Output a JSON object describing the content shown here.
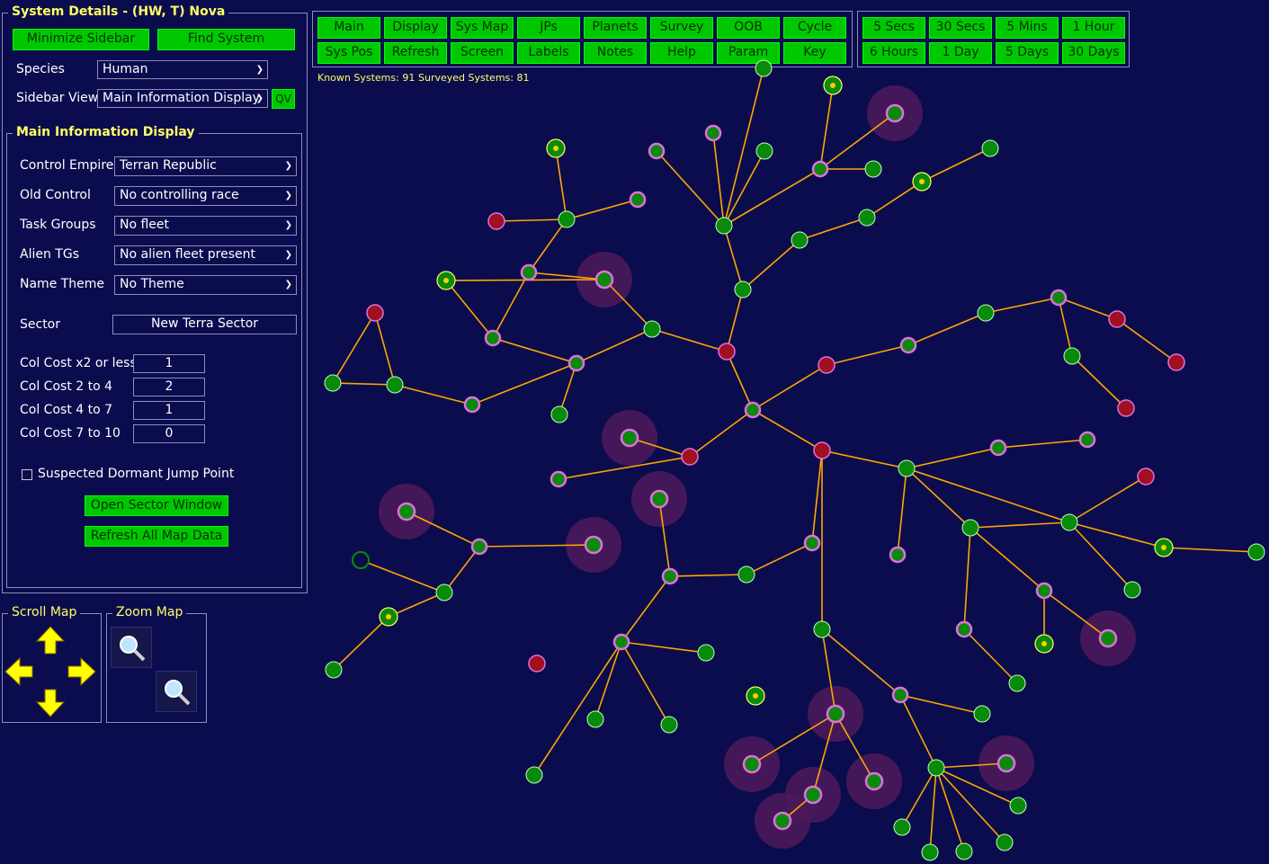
{
  "sidebar": {
    "title": "System Details - (HW, T) Nova",
    "minimize_label": "Minimize Sidebar",
    "find_label": "Find System",
    "species_label": "Species",
    "species_value": "Human",
    "sidebar_view_label": "Sidebar View",
    "sidebar_view_value": "Main Information Display",
    "qv_label": "QV",
    "mid_title": "Main Information Display",
    "rows": [
      {
        "label": "Control Empire",
        "value": "Terran Republic"
      },
      {
        "label": "Old Control",
        "value": "No controlling race"
      },
      {
        "label": "Task Groups",
        "value": "No fleet"
      },
      {
        "label": "Alien TGs",
        "value": "No alien fleet present"
      },
      {
        "label": "Name Theme",
        "value": "No Theme"
      }
    ],
    "sector_label": "Sector",
    "sector_value": "New Terra Sector",
    "col_costs": [
      {
        "label": "Col Cost x2 or less",
        "value": "1"
      },
      {
        "label": "Col Cost 2 to 4",
        "value": "2"
      },
      {
        "label": "Col Cost 4 to 7",
        "value": "1"
      },
      {
        "label": "Col Cost 7 to 10",
        "value": "0"
      }
    ],
    "dormant_label": "Suspected Dormant Jump Point",
    "open_sector_label": "Open Sector Window",
    "refresh_label": "Refresh All Map Data",
    "scroll_title": "Scroll Map",
    "zoom_title": "Zoom Map"
  },
  "toolbar": {
    "row1": [
      "Main",
      "Display",
      "Sys Map",
      "JPs",
      "Planets",
      "Survey",
      "OOB",
      "Cycle"
    ],
    "row2": [
      "Sys Pos",
      "Refresh",
      "Screen",
      "Labels",
      "Notes",
      "Help",
      "Param",
      "Key"
    ],
    "time_row1": [
      "5 Secs",
      "30 Secs",
      "5 Mins",
      "1 Hour"
    ],
    "time_row2": [
      "6 Hours",
      "1 Day",
      "5 Days",
      "30 Days"
    ]
  },
  "stats": {
    "known_label": "Known Systems:",
    "known_value": "91",
    "surveyed_label": "Surveyed Systems:",
    "surveyed_value": "81"
  },
  "colors": {
    "background": "#0b0c4e",
    "button": "#00c800",
    "title": "#ffff66",
    "jump_line": "#ffa500",
    "node_green": "#0a8a0a",
    "node_pink": "#e070e0",
    "node_red": "#a01020",
    "nebula": "#4a1a5a"
  }
}
